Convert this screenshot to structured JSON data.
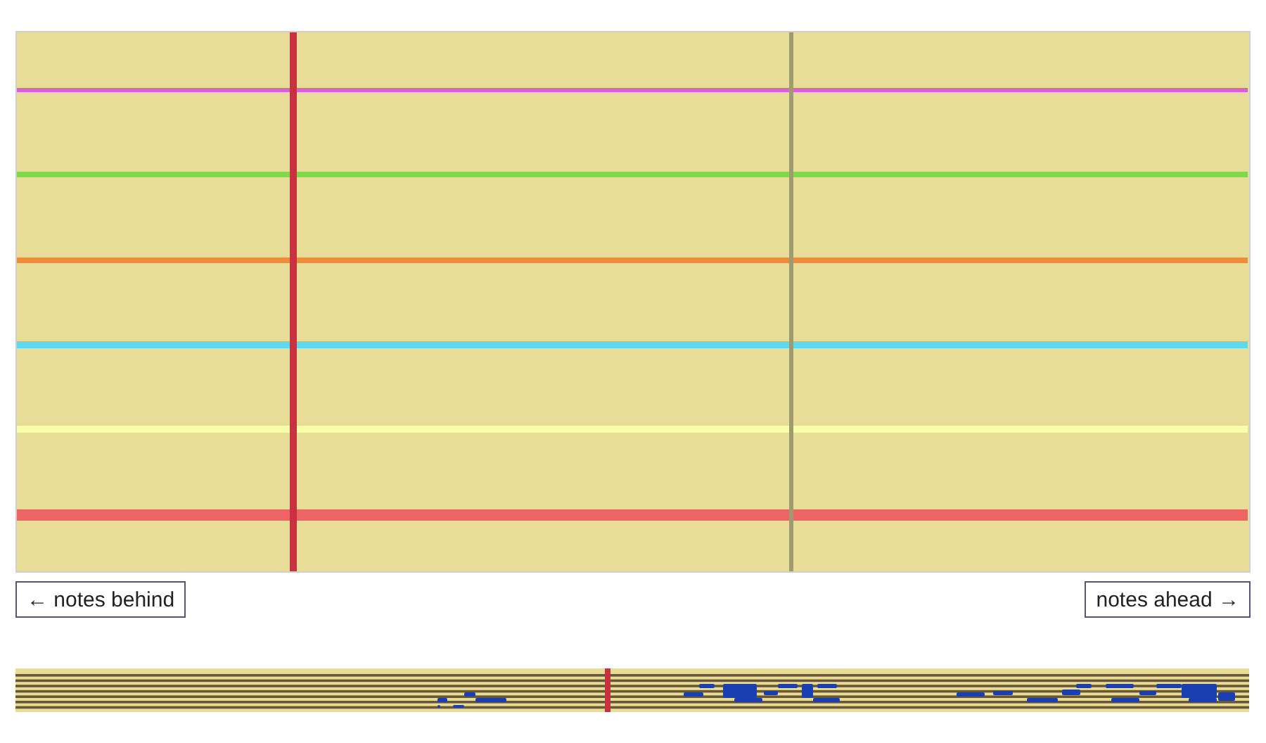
{
  "strings": [
    {
      "color": "#d95fd9"
    },
    {
      "color": "#7fd94a"
    },
    {
      "color": "#ee8c3a"
    },
    {
      "color": "#5fd9ee"
    },
    {
      "color": "#f7ffa8"
    },
    {
      "color": "#ee6464"
    }
  ],
  "buttons": [
    {
      "label": "← notes behind"
    },
    {
      "label": "notes ahead →"
    }
  ]
}
